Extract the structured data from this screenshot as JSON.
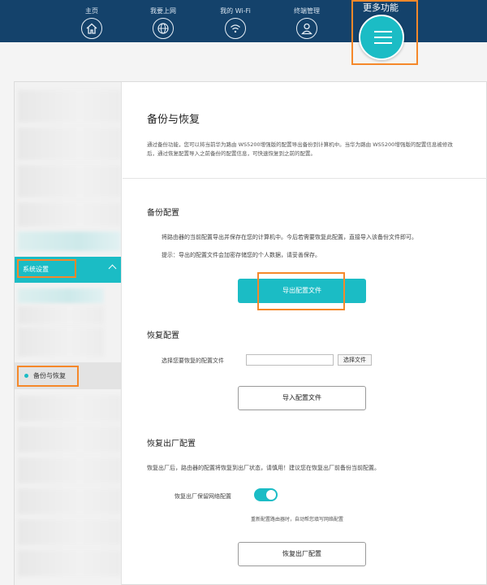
{
  "topnav": {
    "items": [
      {
        "label": "主页",
        "icon": "home-icon"
      },
      {
        "label": "我要上网",
        "icon": "globe-icon"
      },
      {
        "label": "我的 Wi-Fi",
        "icon": "wifi-icon"
      },
      {
        "label": "终端管理",
        "icon": "user-icon"
      }
    ],
    "more": {
      "label": "更多功能",
      "icon": "menu-icon"
    }
  },
  "sidebar": {
    "section_label": "系统设置",
    "active_item_label": "备份与恢复"
  },
  "content": {
    "title": "备份与恢复",
    "description": "通过备份功能，您可以将当前华为路由 WS5200增强版的配置导出备份到计算机中。当华为路由 WS5200增强版的配置信息被修改后，通过恢复配置导入之前备份的配置信息，可快速恢复到之前的配置。",
    "backup": {
      "title": "备份配置",
      "desc": "将路由器的当前配置导出并保存在您的计算机中。今后若需要恢复此配置，直接导入该备份文件即可。",
      "hint": "提示：导出的配置文件会加密存储您的个人数据，请妥善保存。",
      "export_button": "导出配置文件"
    },
    "restore": {
      "title": "恢复配置",
      "file_label": "选择您要恢复的配置文件",
      "file_value": "",
      "choose_button": "选择文件",
      "import_button": "导入配置文件"
    },
    "factory": {
      "title": "恢复出厂配置",
      "desc": "恢复出厂后，路由器的配置将恢复到出厂状态，请慎用！建议您在恢复出厂前备份当前配置。",
      "toggle_label": "恢复出厂保留网络配置",
      "toggle_on": true,
      "toggle_hint": "重新配置路由器时，自动帮您填写网络配置",
      "reset_button": "恢复出厂配置"
    }
  },
  "colors": {
    "nav_bg": "#14426b",
    "accent": "#1bbcc5",
    "highlight": "#f5882a"
  }
}
